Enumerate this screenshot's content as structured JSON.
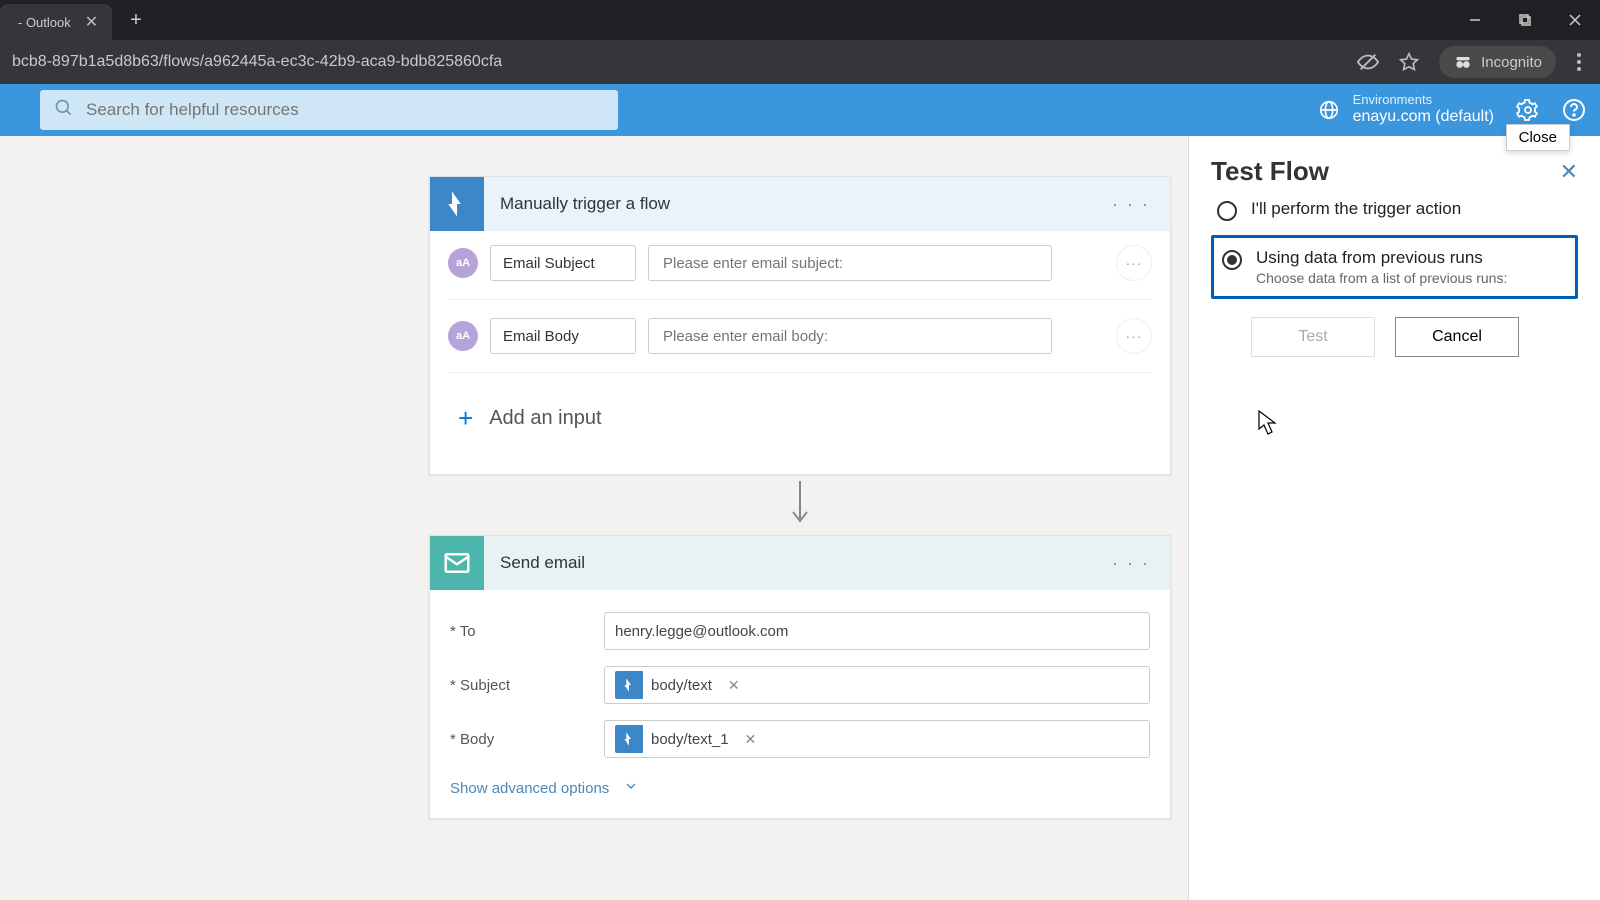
{
  "browser": {
    "tab_title": " - Outlook",
    "url_fragment": "bcb8-897b1a5d8b63/flows/a962445a-ec3c-42b9-aca9-bdb825860cfa",
    "incognito_label": "Incognito"
  },
  "header": {
    "search_placeholder": "Search for helpful resources",
    "env_label": "Environments",
    "env_value": "enayu.com (default)",
    "close_tooltip": "Close"
  },
  "trigger_card": {
    "title": "Manually trigger a flow",
    "rows": [
      {
        "name": "Email Subject",
        "placeholder": "Please enter email subject:"
      },
      {
        "name": "Email Body",
        "placeholder": "Please enter email body:"
      }
    ],
    "add_input_label": "Add an input"
  },
  "action_card": {
    "title": "Send email",
    "fields": {
      "to_label": "To",
      "to_value": "henry.legge@outlook.com",
      "subject_label": "Subject",
      "subject_token": "body/text",
      "body_label": "Body",
      "body_token": "body/text_1"
    },
    "show_advanced": "Show advanced options"
  },
  "panel": {
    "title": "Test Flow",
    "opt1": "I'll perform the trigger action",
    "opt2": "Using data from previous runs",
    "opt2_sub": "Choose data from a list of previous runs:",
    "test_btn": "Test",
    "cancel_btn": "Cancel"
  }
}
